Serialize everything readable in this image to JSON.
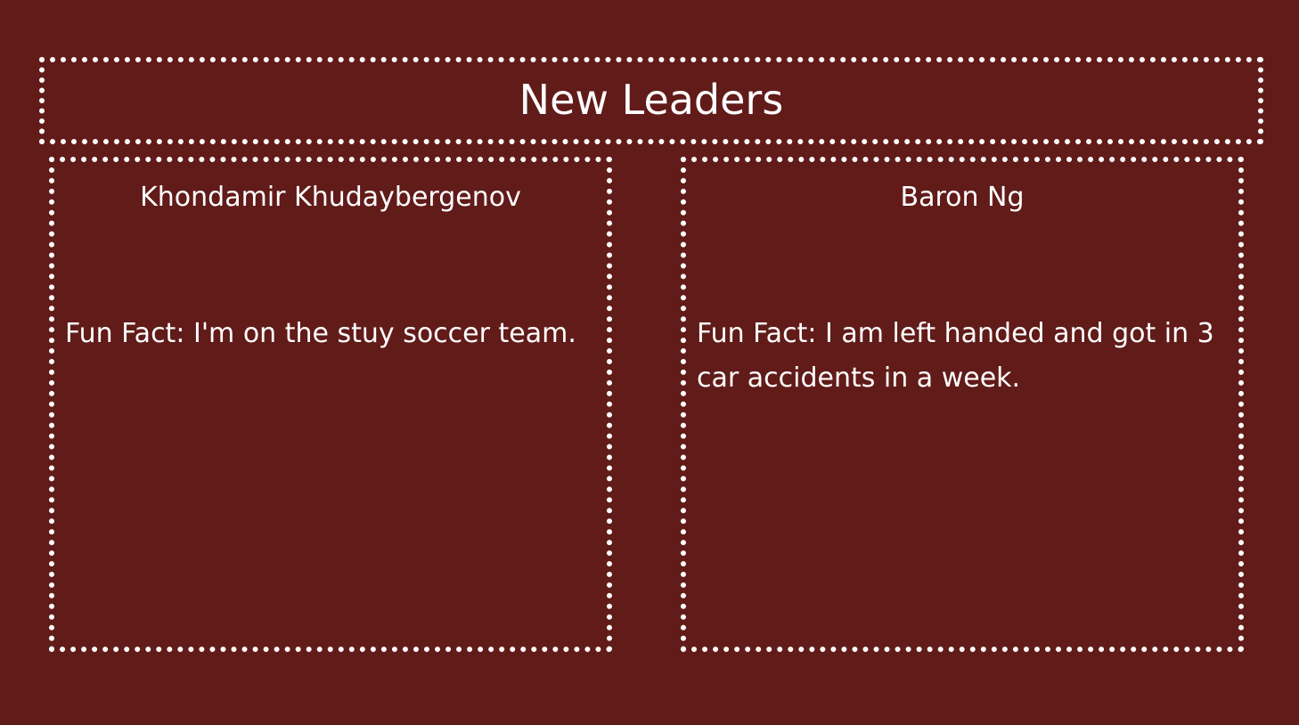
{
  "slide": {
    "title": "New Leaders",
    "leaders": [
      {
        "name": "Khondamir Khudaybergenov",
        "fun_fact": "Fun Fact: I'm on the stuy soccer team."
      },
      {
        "name": "Baron Ng",
        "fun_fact": "Fun Fact: I am left handed and got in 3 car accidents in a week."
      }
    ]
  },
  "colors": {
    "background": "#611b19",
    "text": "#ffffff",
    "border": "#ffffff"
  }
}
